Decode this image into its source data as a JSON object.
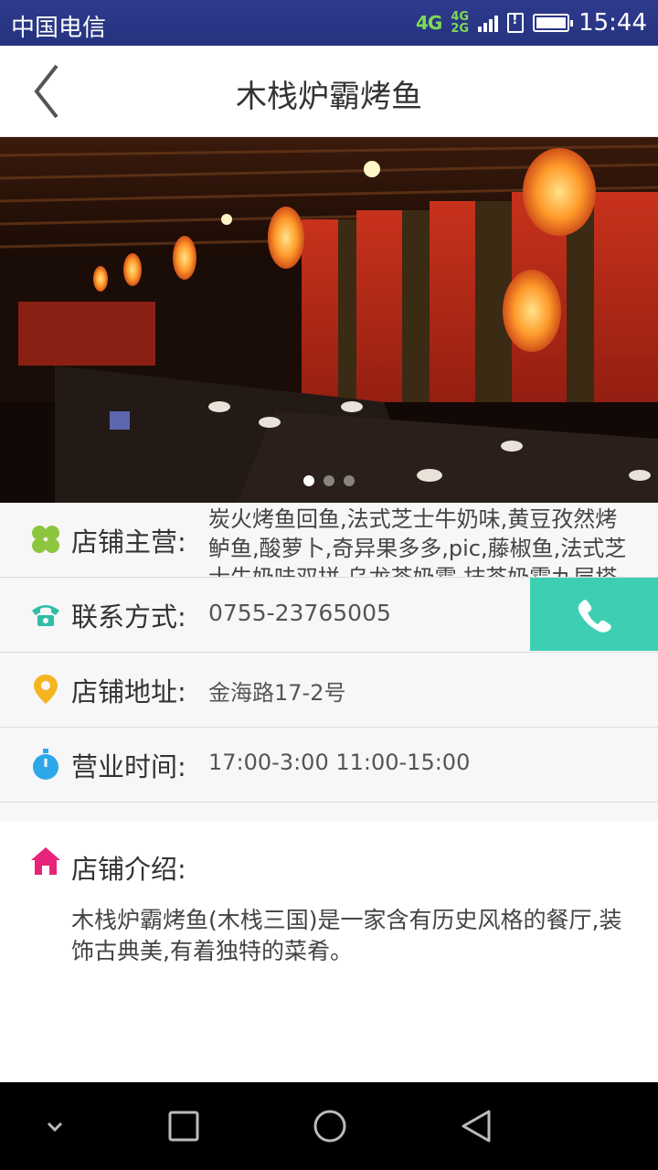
{
  "status_bar": {
    "carrier": "中国电信",
    "network_primary": "4G",
    "network_stack_top": "4G",
    "network_stack_bottom": "2G",
    "time": "15:44"
  },
  "header": {
    "title": "木栈炉霸烤鱼",
    "back_icon": "chevron-left-icon"
  },
  "banner": {
    "image_description": "restaurant-interior-photo",
    "slide_count": 3,
    "active_slide": 1
  },
  "info": {
    "main_items": {
      "label": "店铺主营:",
      "value": "炭火烤鱼回鱼,法式芝士牛奶味,黄豆孜然烤鲈鱼,酸萝卜,奇异果多多,pic,藤椒鱼,法式芝士牛奶味双拼,乌龙茶奶霜,抹茶奶霜九层塔",
      "icon": "clover-icon",
      "icon_color": "#8cc63f"
    },
    "contact": {
      "label": "联系方式:",
      "value": "0755-23765005",
      "icon": "phone-icon",
      "icon_color": "#2fbfa5",
      "call_button_color": "#3ecfb3"
    },
    "address": {
      "label": "店铺地址:",
      "value": "金海路17-2号",
      "icon": "location-pin-icon",
      "icon_color": "#f5b521"
    },
    "hours": {
      "label": "营业时间:",
      "value": "17:00-3:00 11:00-15:00",
      "icon": "stopwatch-icon",
      "icon_color": "#2ea7e8"
    }
  },
  "intro": {
    "label": "店铺介绍:",
    "body": "木栈炉霸烤鱼(木栈三国)是一家含有历史风格的餐厅,装饰古典美,有着独特的菜肴。",
    "icon": "home-icon",
    "icon_color": "#e8237a"
  },
  "nav_bar": {
    "items": [
      "chevron-down-icon",
      "square-recents-icon",
      "circle-home-icon",
      "triangle-back-icon"
    ]
  }
}
